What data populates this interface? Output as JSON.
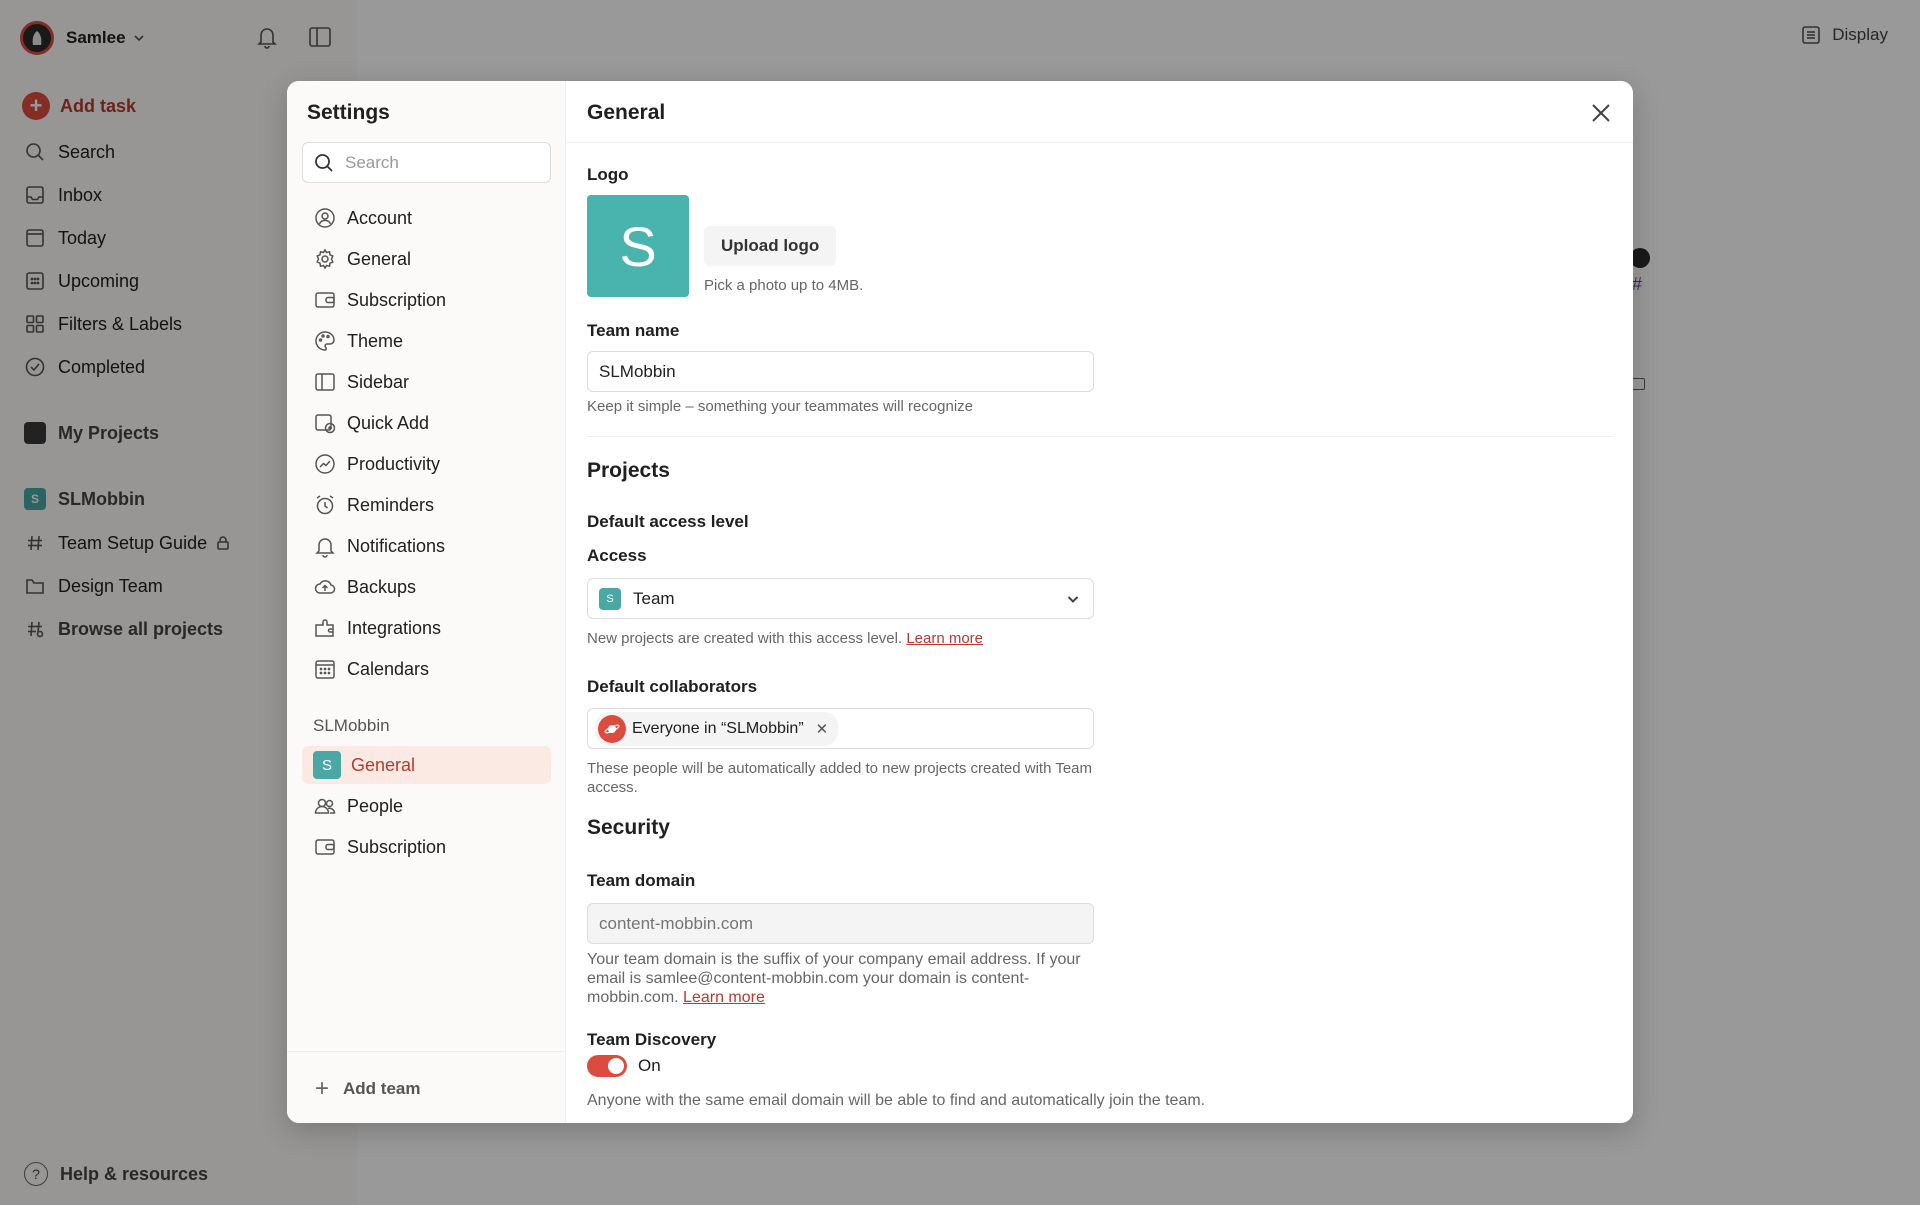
{
  "user": {
    "name": "Samlee"
  },
  "left_nav": {
    "add_task": "Add task",
    "items": [
      {
        "label": "Search"
      },
      {
        "label": "Inbox"
      },
      {
        "label": "Today"
      },
      {
        "label": "Upcoming"
      },
      {
        "label": "Filters & Labels"
      },
      {
        "label": "Completed"
      }
    ],
    "my_projects": "My Projects",
    "team": {
      "name": "SLMobbin",
      "logo_letter": "S"
    },
    "team_items": [
      {
        "label": "Team Setup Guide"
      },
      {
        "label": "Design Team"
      },
      {
        "label": "Browse all projects"
      }
    ],
    "help": "Help & resources"
  },
  "toolbar": {
    "display": "Display"
  },
  "settings": {
    "title": "Settings",
    "search_placeholder": "Search",
    "menu": [
      {
        "label": "Account",
        "icon": "user-circle-icon"
      },
      {
        "label": "General",
        "icon": "gear-icon"
      },
      {
        "label": "Subscription",
        "icon": "wallet-icon"
      },
      {
        "label": "Theme",
        "icon": "palette-icon"
      },
      {
        "label": "Sidebar",
        "icon": "sidebar-icon"
      },
      {
        "label": "Quick Add",
        "icon": "quick-add-icon"
      },
      {
        "label": "Productivity",
        "icon": "chart-icon"
      },
      {
        "label": "Reminders",
        "icon": "alarm-icon"
      },
      {
        "label": "Notifications",
        "icon": "bell-icon"
      },
      {
        "label": "Backups",
        "icon": "cloud-icon"
      },
      {
        "label": "Integrations",
        "icon": "plug-icon"
      },
      {
        "label": "Calendars",
        "icon": "calendar-icon"
      }
    ],
    "team_label": "SLMobbin",
    "team_menu": [
      {
        "label": "General",
        "active": true
      },
      {
        "label": "People"
      },
      {
        "label": "Subscription"
      }
    ],
    "add_team": "Add team"
  },
  "general": {
    "title": "General",
    "logo_label": "Logo",
    "logo_letter": "S",
    "upload_logo": "Upload logo",
    "upload_hint": "Pick a photo up to 4MB.",
    "team_name_label": "Team name",
    "team_name_value": "SLMobbin",
    "team_name_hint": "Keep it simple – something your teammates will recognize",
    "projects_heading": "Projects",
    "default_access_label": "Default access level",
    "access_label": "Access",
    "access_value": "Team",
    "access_hint": "New projects are created with this access level.",
    "learn_more": "Learn more",
    "default_collab_label": "Default collaborators",
    "collab_chip": "Everyone in “SLMobbin”",
    "collab_hint": "These people will be automatically added to new projects created with Team access.",
    "security_heading": "Security",
    "team_domain_label": "Team domain",
    "team_domain_placeholder": "content-mobbin.com",
    "team_domain_hint": "Your team domain is the suffix of your company email address. If your email is samlee@content-mobbin.com your domain is content-mobbin.com.",
    "team_discovery_label": "Team Discovery",
    "team_discovery_state": "On",
    "team_discovery_hint": "Anyone with the same email domain will be able to find and automatically join the team."
  },
  "colors": {
    "accent": "#dc4c3e",
    "team_logo": "#49b3ad"
  }
}
